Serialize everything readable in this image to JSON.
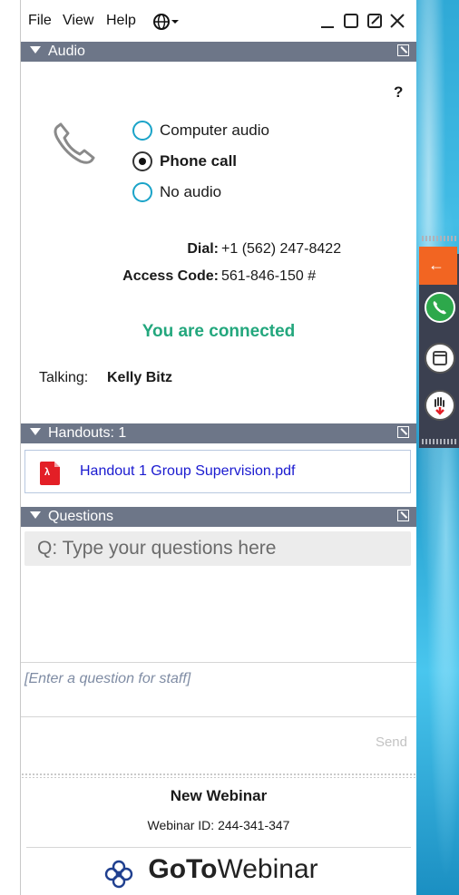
{
  "menu": {
    "file": "File",
    "view": "View",
    "help": "Help"
  },
  "audio": {
    "title": "Audio",
    "help": "?",
    "options": [
      "Computer audio",
      "Phone call",
      "No audio"
    ],
    "selected": "Phone call",
    "dial_label": "Dial:",
    "dial_value": "+1 (562) 247-8422",
    "access_label": "Access Code:",
    "access_value": "561-846-150 #",
    "status": "You are connected",
    "talking_label": "Talking:",
    "talking_name": "Kelly Bitz"
  },
  "handouts": {
    "title": "Handouts: 1",
    "file": "Handout 1 Group Supervision.pdf"
  },
  "questions": {
    "title": "Questions",
    "search_placeholder": "Q: Type your questions here",
    "input_placeholder": "[Enter a question for staff]",
    "send": "Send"
  },
  "footer": {
    "webinar_name": "New Webinar",
    "webinar_id": "Webinar ID: 244-341-347",
    "brand_bold": "GoTo",
    "brand_rest": "Webinar"
  },
  "colors": {
    "connected": "#23a77d",
    "header": "#6d7688",
    "link": "#1a1ad0",
    "accent": "#f26522"
  }
}
